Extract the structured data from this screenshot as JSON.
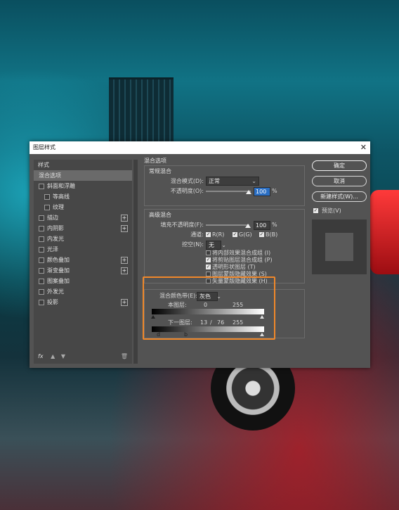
{
  "dialog": {
    "title": "图层样式"
  },
  "left_panel": {
    "header": "样式",
    "items": [
      {
        "label": "混合选项",
        "selected": true,
        "checkbox": false,
        "plus": false,
        "indent": false
      },
      {
        "label": "斜面和浮雕",
        "checkbox": true,
        "plus": false,
        "indent": false
      },
      {
        "label": "等高线",
        "checkbox": true,
        "plus": false,
        "indent": true
      },
      {
        "label": "纹理",
        "checkbox": true,
        "plus": false,
        "indent": true
      },
      {
        "label": "描边",
        "checkbox": true,
        "plus": true,
        "indent": false
      },
      {
        "label": "内阴影",
        "checkbox": true,
        "plus": true,
        "indent": false
      },
      {
        "label": "内发光",
        "checkbox": true,
        "plus": false,
        "indent": false
      },
      {
        "label": "光泽",
        "checkbox": true,
        "plus": false,
        "indent": false
      },
      {
        "label": "颜色叠加",
        "checkbox": true,
        "plus": true,
        "indent": false
      },
      {
        "label": "渐变叠加",
        "checkbox": true,
        "plus": true,
        "indent": false
      },
      {
        "label": "图案叠加",
        "checkbox": true,
        "plus": false,
        "indent": false
      },
      {
        "label": "外发光",
        "checkbox": true,
        "plus": false,
        "indent": false
      },
      {
        "label": "投影",
        "checkbox": true,
        "plus": true,
        "indent": false
      }
    ],
    "fx_label": "fx"
  },
  "blend": {
    "section_title": "混合选项",
    "general": {
      "title": "常规混合",
      "mode_label": "混合模式(D):",
      "mode_value": "正常",
      "opacity_label": "不透明度(O):",
      "opacity_value": "100",
      "opacity_unit": "%"
    },
    "advanced": {
      "title": "高级混合",
      "fill_label": "填充不透明度(F):",
      "fill_value": "100",
      "fill_unit": "%",
      "channels_label": "通道:",
      "channel_r": "R(R)",
      "channel_g": "G(G)",
      "channel_b": "B(B)",
      "knockout_label": "挖空(N):",
      "knockout_value": "无",
      "options": [
        {
          "label": "将内部效果混合成组 (I)",
          "checked": false
        },
        {
          "label": "将剪贴图层混合成组 (P)",
          "checked": true
        },
        {
          "label": "透明形状图层 (T)",
          "checked": true
        },
        {
          "label": "图层蒙版隐藏效果 (S)",
          "checked": false
        },
        {
          "label": "矢量蒙版隐藏效果 (H)",
          "checked": false
        }
      ]
    },
    "blend_if": {
      "label": "混合颜色带(E):",
      "value": "灰色",
      "this_layer_label": "本图层:",
      "this_layer_low": "0",
      "this_layer_high": "255",
      "underlying_label": "下一图层:",
      "underlying_low": "13",
      "underlying_sep": "/",
      "underlying_mid": "76",
      "underlying_high": "255",
      "marker_left": "0",
      "marker_d": "d",
      "marker_b": "b"
    }
  },
  "buttons": {
    "ok": "确定",
    "cancel": "取消",
    "new_style": "新建样式(W)...",
    "preview_label": "预览(V)"
  },
  "colors": {
    "highlight": "#f0882a",
    "dialog_bg": "#535353",
    "focus": "#2b6fc4"
  }
}
